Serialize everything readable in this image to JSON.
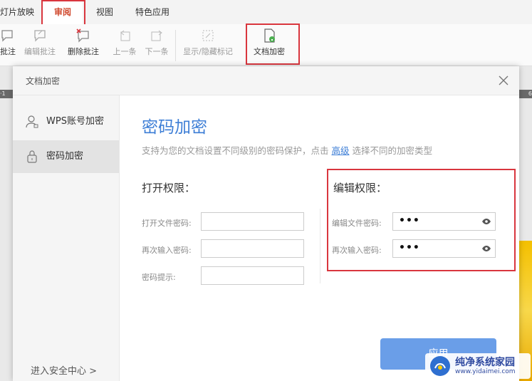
{
  "ribbon": {
    "tabs": [
      "灯片放映",
      "审阅",
      "视图",
      "特色应用"
    ],
    "tools": [
      "批注",
      "编辑批注",
      "删除批注",
      "上一条",
      "下一条",
      "显示/隐藏标记",
      "文档加密"
    ]
  },
  "ruler": {
    "left": "·1",
    "right": "6"
  },
  "dialog": {
    "title": "文档加密",
    "sidebar": {
      "items": [
        "WPS账号加密",
        "密码加密"
      ],
      "footer": "进入安全中心 >"
    },
    "main": {
      "title": "密码加密",
      "desc_prefix": "支持为您的文档设置不同级别的密码保护，点击 ",
      "desc_link": "高级",
      "desc_suffix": " 选择不同的加密类型",
      "open_section": {
        "title": "打开权限：",
        "labels": [
          "打开文件密码:",
          "再次输入密码:",
          "密码提示:"
        ]
      },
      "edit_section": {
        "title": "编辑权限：",
        "labels": [
          "编辑文件密码:",
          "再次输入密码:"
        ],
        "values": [
          "•••",
          "•••"
        ]
      },
      "apply_label": "应用"
    }
  },
  "watermark": {
    "title": "纯净系统家园",
    "url": "www.yidaimei.com"
  },
  "colors": {
    "accent": "#3d7ed6",
    "highlight": "#d9363e",
    "active_tab": "#d04a2f"
  }
}
